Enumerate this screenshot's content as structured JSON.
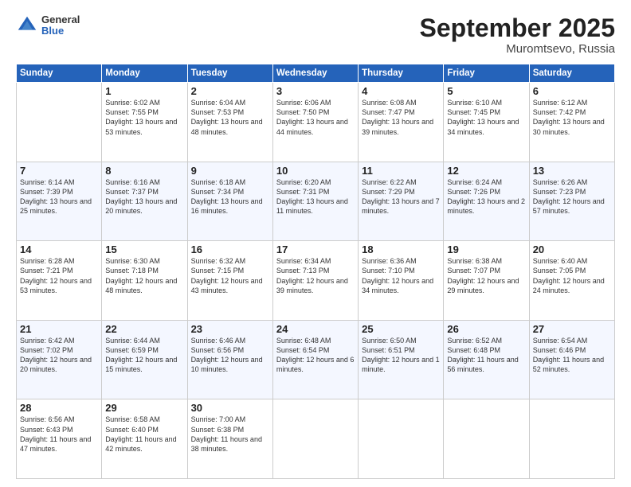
{
  "header": {
    "logo": {
      "general": "General",
      "blue": "Blue"
    },
    "title": "September 2025",
    "location": "Muromtsevo, Russia"
  },
  "days_of_week": [
    "Sunday",
    "Monday",
    "Tuesday",
    "Wednesday",
    "Thursday",
    "Friday",
    "Saturday"
  ],
  "weeks": [
    [
      null,
      {
        "day": 1,
        "sunrise": "6:02 AM",
        "sunset": "7:55 PM",
        "daylight": "13 hours and 53 minutes."
      },
      {
        "day": 2,
        "sunrise": "6:04 AM",
        "sunset": "7:53 PM",
        "daylight": "13 hours and 48 minutes."
      },
      {
        "day": 3,
        "sunrise": "6:06 AM",
        "sunset": "7:50 PM",
        "daylight": "13 hours and 44 minutes."
      },
      {
        "day": 4,
        "sunrise": "6:08 AM",
        "sunset": "7:47 PM",
        "daylight": "13 hours and 39 minutes."
      },
      {
        "day": 5,
        "sunrise": "6:10 AM",
        "sunset": "7:45 PM",
        "daylight": "13 hours and 34 minutes."
      },
      {
        "day": 6,
        "sunrise": "6:12 AM",
        "sunset": "7:42 PM",
        "daylight": "13 hours and 30 minutes."
      }
    ],
    [
      {
        "day": 7,
        "sunrise": "6:14 AM",
        "sunset": "7:39 PM",
        "daylight": "13 hours and 25 minutes."
      },
      {
        "day": 8,
        "sunrise": "6:16 AM",
        "sunset": "7:37 PM",
        "daylight": "13 hours and 20 minutes."
      },
      {
        "day": 9,
        "sunrise": "6:18 AM",
        "sunset": "7:34 PM",
        "daylight": "13 hours and 16 minutes."
      },
      {
        "day": 10,
        "sunrise": "6:20 AM",
        "sunset": "7:31 PM",
        "daylight": "13 hours and 11 minutes."
      },
      {
        "day": 11,
        "sunrise": "6:22 AM",
        "sunset": "7:29 PM",
        "daylight": "13 hours and 7 minutes."
      },
      {
        "day": 12,
        "sunrise": "6:24 AM",
        "sunset": "7:26 PM",
        "daylight": "13 hours and 2 minutes."
      },
      {
        "day": 13,
        "sunrise": "6:26 AM",
        "sunset": "7:23 PM",
        "daylight": "12 hours and 57 minutes."
      }
    ],
    [
      {
        "day": 14,
        "sunrise": "6:28 AM",
        "sunset": "7:21 PM",
        "daylight": "12 hours and 53 minutes."
      },
      {
        "day": 15,
        "sunrise": "6:30 AM",
        "sunset": "7:18 PM",
        "daylight": "12 hours and 48 minutes."
      },
      {
        "day": 16,
        "sunrise": "6:32 AM",
        "sunset": "7:15 PM",
        "daylight": "12 hours and 43 minutes."
      },
      {
        "day": 17,
        "sunrise": "6:34 AM",
        "sunset": "7:13 PM",
        "daylight": "12 hours and 39 minutes."
      },
      {
        "day": 18,
        "sunrise": "6:36 AM",
        "sunset": "7:10 PM",
        "daylight": "12 hours and 34 minutes."
      },
      {
        "day": 19,
        "sunrise": "6:38 AM",
        "sunset": "7:07 PM",
        "daylight": "12 hours and 29 minutes."
      },
      {
        "day": 20,
        "sunrise": "6:40 AM",
        "sunset": "7:05 PM",
        "daylight": "12 hours and 24 minutes."
      }
    ],
    [
      {
        "day": 21,
        "sunrise": "6:42 AM",
        "sunset": "7:02 PM",
        "daylight": "12 hours and 20 minutes."
      },
      {
        "day": 22,
        "sunrise": "6:44 AM",
        "sunset": "6:59 PM",
        "daylight": "12 hours and 15 minutes."
      },
      {
        "day": 23,
        "sunrise": "6:46 AM",
        "sunset": "6:56 PM",
        "daylight": "12 hours and 10 minutes."
      },
      {
        "day": 24,
        "sunrise": "6:48 AM",
        "sunset": "6:54 PM",
        "daylight": "12 hours and 6 minutes."
      },
      {
        "day": 25,
        "sunrise": "6:50 AM",
        "sunset": "6:51 PM",
        "daylight": "12 hours and 1 minute."
      },
      {
        "day": 26,
        "sunrise": "6:52 AM",
        "sunset": "6:48 PM",
        "daylight": "11 hours and 56 minutes."
      },
      {
        "day": 27,
        "sunrise": "6:54 AM",
        "sunset": "6:46 PM",
        "daylight": "11 hours and 52 minutes."
      }
    ],
    [
      {
        "day": 28,
        "sunrise": "6:56 AM",
        "sunset": "6:43 PM",
        "daylight": "11 hours and 47 minutes."
      },
      {
        "day": 29,
        "sunrise": "6:58 AM",
        "sunset": "6:40 PM",
        "daylight": "11 hours and 42 minutes."
      },
      {
        "day": 30,
        "sunrise": "7:00 AM",
        "sunset": "6:38 PM",
        "daylight": "11 hours and 38 minutes."
      },
      null,
      null,
      null,
      null
    ]
  ]
}
